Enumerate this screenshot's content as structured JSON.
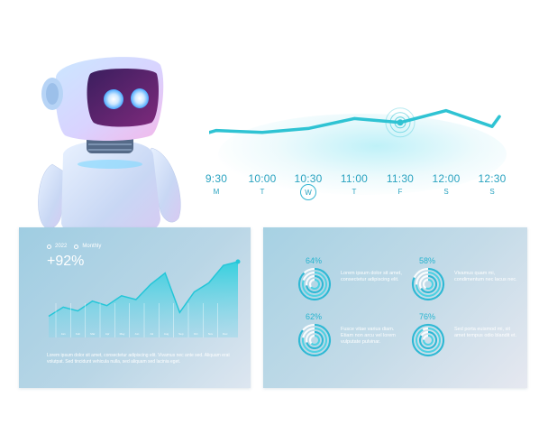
{
  "timeline": {
    "series": [
      {
        "time": "9:30",
        "day": "M",
        "active": false,
        "value": 0.35
      },
      {
        "time": "10:00",
        "day": "T",
        "active": false,
        "value": 0.3
      },
      {
        "time": "10:30",
        "day": "W",
        "active": true,
        "value": 0.4
      },
      {
        "time": "11:00",
        "day": "T",
        "active": false,
        "value": 0.65
      },
      {
        "time": "11:30",
        "day": "F",
        "active": false,
        "value": 0.55
      },
      {
        "time": "12:00",
        "day": "S",
        "active": false,
        "value": 0.85
      },
      {
        "time": "12:30",
        "day": "S",
        "active": false,
        "value": 0.45
      }
    ],
    "highlight_index": 4,
    "color": "#2fc3d3"
  },
  "left_panel": {
    "year": "2022",
    "period": "Monthly",
    "change": "+92%",
    "chart_data": {
      "type": "area",
      "values": [
        0.28,
        0.4,
        0.35,
        0.48,
        0.42,
        0.55,
        0.5,
        0.7,
        0.85,
        0.33,
        0.6,
        0.72,
        0.95,
        1.0
      ],
      "month_labels": [
        "Jan",
        "Feb",
        "Mar",
        "Apr",
        "May",
        "Jun",
        "Jul",
        "Aug",
        "Sep",
        "Oct",
        "Nov",
        "Dec"
      ]
    },
    "description": "Lorem ipsum dolor sit amet, consectetur adipiscing elit. Vivamus nec ante sed. Aliquam erat volutpat. Sed tincidunt vehicula nulla, sed aliquam sed lacinia eget."
  },
  "right_panel": {
    "stats": [
      {
        "percent": "64%",
        "value": 0.64,
        "text": "Lorem ipsum dolor sit amet, consectetur adipiscing elit."
      },
      {
        "percent": "58%",
        "value": 0.58,
        "text": "Vivamus quam mi, condimentum nec lacus nec."
      },
      {
        "percent": "62%",
        "value": 0.62,
        "text": "Fusce vitae varius diam. Etiam non arcu vel lorem vulputate pulvinar."
      },
      {
        "percent": "76%",
        "value": 0.76,
        "text": "Sed porta euismod mi, sit amet tempus odio blandit et."
      }
    ]
  },
  "colors": {
    "accent": "#2fc3d3",
    "panel": "#a9d3e4"
  }
}
